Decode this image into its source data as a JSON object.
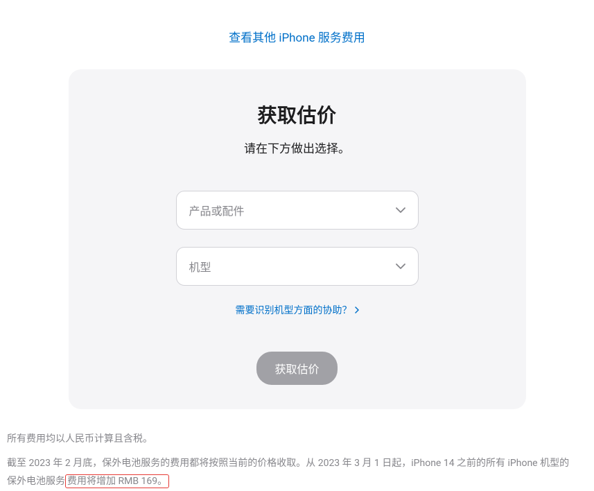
{
  "topLink": {
    "label": "查看其他 iPhone 服务费用"
  },
  "card": {
    "title": "获取估价",
    "subtitle": "请在下方做出选择。",
    "select1": {
      "placeholder": "产品或配件"
    },
    "select2": {
      "placeholder": "机型"
    },
    "helpLink": {
      "label": "需要识别机型方面的协助？"
    },
    "button": {
      "label": "获取估价"
    }
  },
  "footer": {
    "line1": "所有费用均以人民币计算且含税。",
    "line2_part1": "截至 2023 年 2 月底，保外电池服务的费用都将按照当前的价格收取。从 2023 年 3 月 1 日起，iPhone 14 之前的所有 iPhone 机型的保外电池服务",
    "line2_part2": "费用将增加 RMB 169。"
  }
}
